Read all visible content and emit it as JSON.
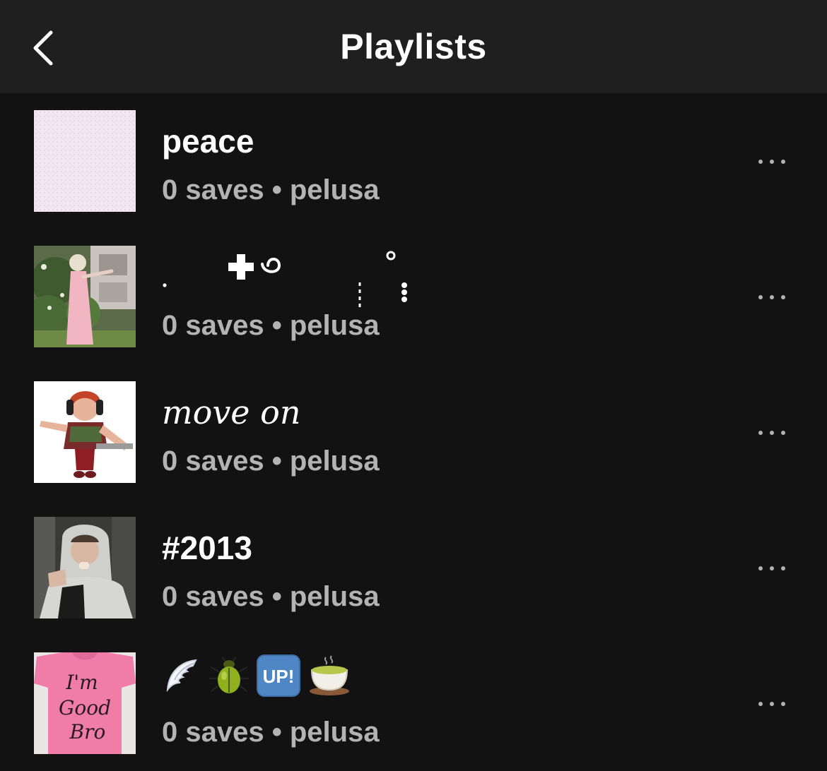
{
  "header": {
    "title": "Playlists",
    "back_icon": "chevron-left-icon"
  },
  "playlists": [
    {
      "title": "peace",
      "saves": "0 saves",
      "separator": "•",
      "owner": "pelusa",
      "cover": "pale pink pattern"
    },
    {
      "title": ".  ✚ ໑  ⁝ ° ⁝",
      "saves": "0 saves",
      "separator": "•",
      "owner": "pelusa",
      "cover": "girl in pink dress by bushes"
    },
    {
      "title": "move on",
      "saves": "0 saves",
      "separator": "•",
      "owner": "pelusa",
      "cover": "girl with headphones"
    },
    {
      "title": "#2013",
      "saves": "0 saves",
      "separator": "•",
      "owner": "pelusa",
      "cover": "person in white hoodie"
    },
    {
      "title": "🪽 🪲 🆙 🍵",
      "saves": "0 saves",
      "separator": "•",
      "owner": "pelusa",
      "cover": "pink shirt I'm Good Bro",
      "cover_text": "I'm Good Bro"
    }
  ],
  "colors": {
    "background": "#121212",
    "header": "#1f1f1f",
    "secondary_text": "#b3b3b3"
  }
}
